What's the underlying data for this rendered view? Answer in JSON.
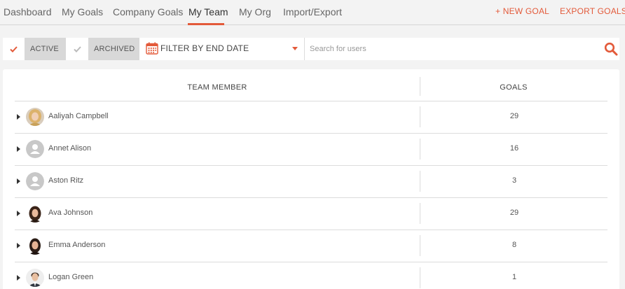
{
  "nav": {
    "tabs": [
      {
        "label": "Dashboard"
      },
      {
        "label": "My Goals"
      },
      {
        "label": "Company Goals"
      },
      {
        "label": "My Team",
        "active": true
      },
      {
        "label": "My Org"
      },
      {
        "label": "Import/Export"
      }
    ],
    "new_goal": "+ NEW GOAL",
    "export_goals": "EXPORT GOALS"
  },
  "filters": {
    "active": {
      "label": "ACTIVE",
      "checked": true
    },
    "archived": {
      "label": "ARCHIVED",
      "checked": false
    },
    "date_filter": "FILTER BY END DATE",
    "search_placeholder": "Search for users",
    "search_value": ""
  },
  "table": {
    "columns": {
      "member": "TEAM MEMBER",
      "goals": "GOALS"
    },
    "rows": [
      {
        "name": "Aaliyah Campbell",
        "goals": "29",
        "avatar": "photo-blonde"
      },
      {
        "name": "Annet Alison",
        "goals": "16",
        "avatar": "placeholder"
      },
      {
        "name": "Aston Ritz",
        "goals": "3",
        "avatar": "placeholder"
      },
      {
        "name": "Ava Johnson",
        "goals": "29",
        "avatar": "photo-brunette"
      },
      {
        "name": "Emma Anderson",
        "goals": "8",
        "avatar": "photo-brunette"
      },
      {
        "name": "Logan Green",
        "goals": "1",
        "avatar": "photo-man"
      }
    ]
  },
  "colors": {
    "accent": "#e35a3a",
    "check_active": "#e35a3a",
    "check_inactive": "#bbbbbb"
  }
}
